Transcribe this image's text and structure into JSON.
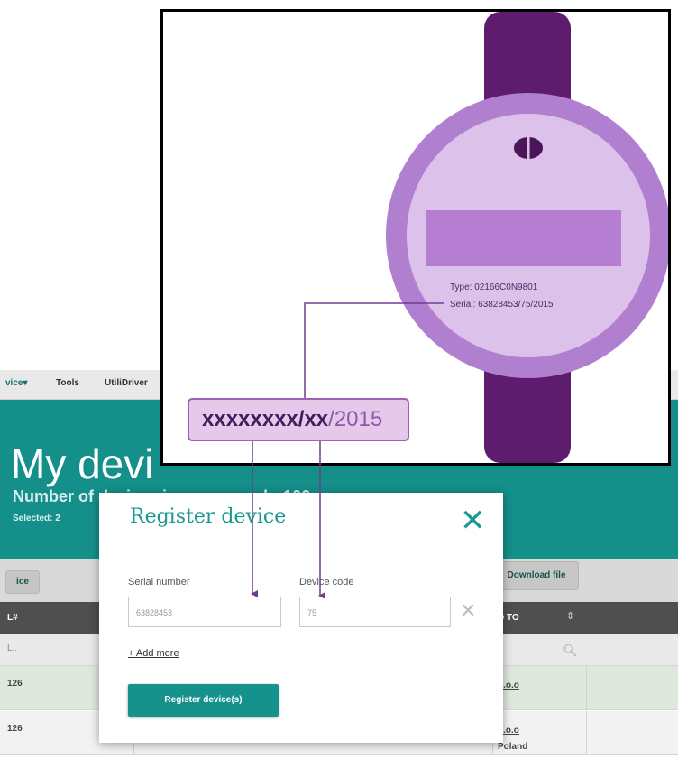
{
  "app": {
    "nav": [
      "vice▾",
      "Tools",
      "UtiliDriver"
    ],
    "hero_title": "My devi",
    "device_count_text": "Number of devices in your search: 106",
    "selected_text": "Selected: 2",
    "toolbar_left_button": "ice",
    "download_button": "Download file",
    "table_headers": [
      "L#",
      "D TO"
    ],
    "filter_placeholder": "L..",
    "rows": [
      {
        "left": "126",
        "right": "Z.o.o"
      },
      {
        "left": "126",
        "right": "Z.o.o",
        "extra": "Poland"
      }
    ]
  },
  "modal": {
    "title": "Register device",
    "serial_label": "Serial number",
    "serial_value": "63828453",
    "code_label": "Device code",
    "code_value": "75",
    "add_more": "+ Add more",
    "register_button": "Register device(s)"
  },
  "illustration": {
    "meter_type": "Type:   02166C0N9801",
    "meter_serial": "Serial:  63828453/75/2015",
    "pattern_part1": "xxxxxxxx/",
    "pattern_part2": "xx",
    "pattern_part3": "/2015",
    "colors": {
      "strap": "#5e1c6e",
      "meter_outer": "#b07fcf",
      "meter_inner": "#dfc4ec",
      "display": "#b57ed3",
      "accent_teal": "#158f8a"
    }
  }
}
